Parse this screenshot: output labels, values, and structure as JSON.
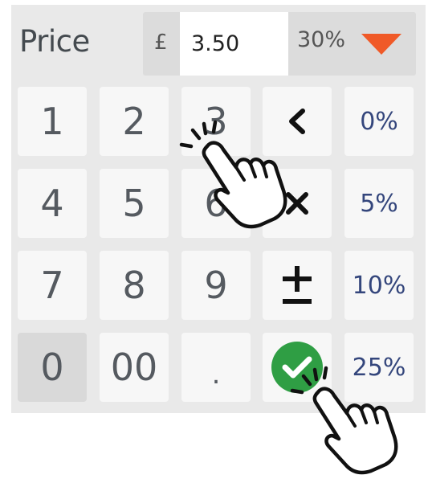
{
  "header": {
    "label": "Price",
    "currency": "£",
    "price_value": "3.50",
    "discount": "30%"
  },
  "keypad": {
    "k1": "1",
    "k2": "2",
    "k3": "3",
    "k4": "4",
    "k5": "5",
    "k6": "6",
    "k7": "7",
    "k8": "8",
    "k9": "9",
    "k0": "0",
    "k00": "00",
    "kdot": "."
  },
  "percent_keys": {
    "p0": "0%",
    "p5": "5%",
    "p10": "10%",
    "p25": "25%"
  },
  "icons": {
    "backspace": "chevron-left-icon",
    "clear": "close-icon",
    "plus_minus": "plus-minus-icon",
    "confirm": "check-circle-icon",
    "pointer": "tap-hand-icon"
  },
  "colors": {
    "accent_arrow": "#f05a28",
    "confirm_green": "#2f9e44",
    "percent_text": "#34467c"
  }
}
